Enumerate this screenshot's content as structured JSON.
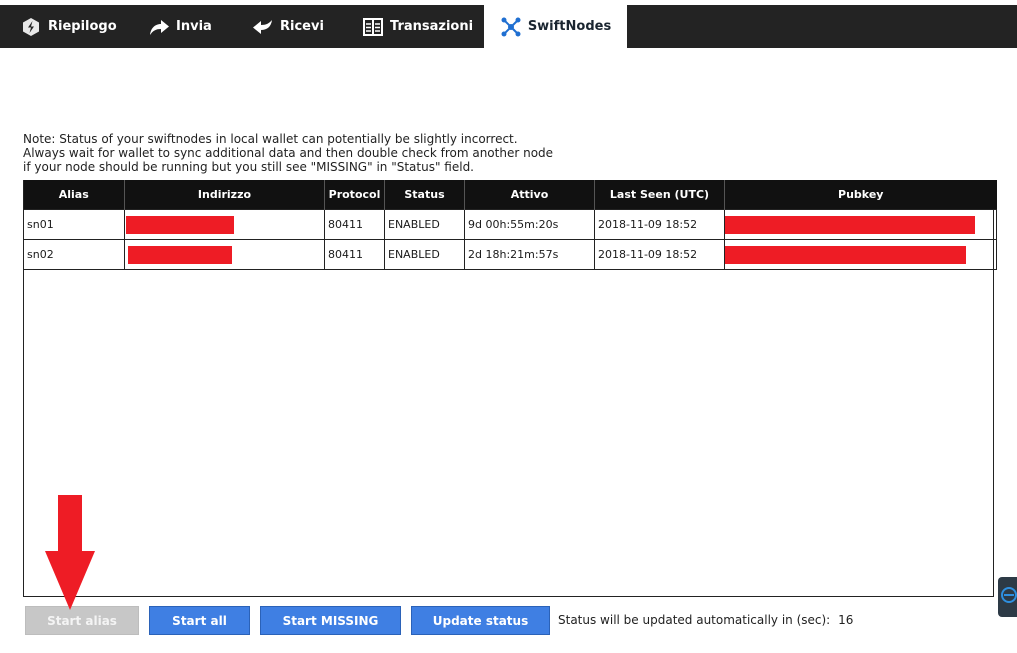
{
  "tabs": [
    {
      "label": "Riepilogo",
      "icon": "overview-icon"
    },
    {
      "label": "Invia",
      "icon": "send-arrow-icon"
    },
    {
      "label": "Ricevi",
      "icon": "receive-arrow-icon"
    },
    {
      "label": "Transazioni",
      "icon": "transactions-icon"
    },
    {
      "label": "SwiftNodes",
      "icon": "nodes-icon"
    }
  ],
  "active_tab": "SwiftNodes",
  "note": {
    "line1": "Note: Status of your swiftnodes in local wallet can potentially be slightly incorrect.",
    "line2": "Always wait for wallet to sync additional data and then double check from another node",
    "line3": "if your node should be running but you still see \"MISSING\" in \"Status\" field."
  },
  "table": {
    "headers": [
      "Alias",
      "Indirizzo",
      "Protocol",
      "Status",
      "Attivo",
      "Last Seen (UTC)",
      "Pubkey"
    ],
    "rows": [
      {
        "alias": "sn01",
        "protocol": "80411",
        "status": "ENABLED",
        "active": "9d 00h:55m:20s",
        "last_seen": "2018-11-09 18:52"
      },
      {
        "alias": "sn02",
        "protocol": "80411",
        "status": "ENABLED",
        "active": "2d 18h:21m:57s",
        "last_seen": "2018-11-09 18:52"
      }
    ]
  },
  "buttons": {
    "start_alias": "Start alias",
    "start_all": "Start all",
    "start_missing": "Start MISSING",
    "update_status": "Update status"
  },
  "auto_update": {
    "label": "Status will be updated automatically in (sec):",
    "seconds": "16"
  },
  "colors": {
    "toolbar_bg": "#232323",
    "button_blue": "#3f7fe3",
    "redaction": "#ee1c25",
    "annotation_arrow": "#ee1c25"
  }
}
